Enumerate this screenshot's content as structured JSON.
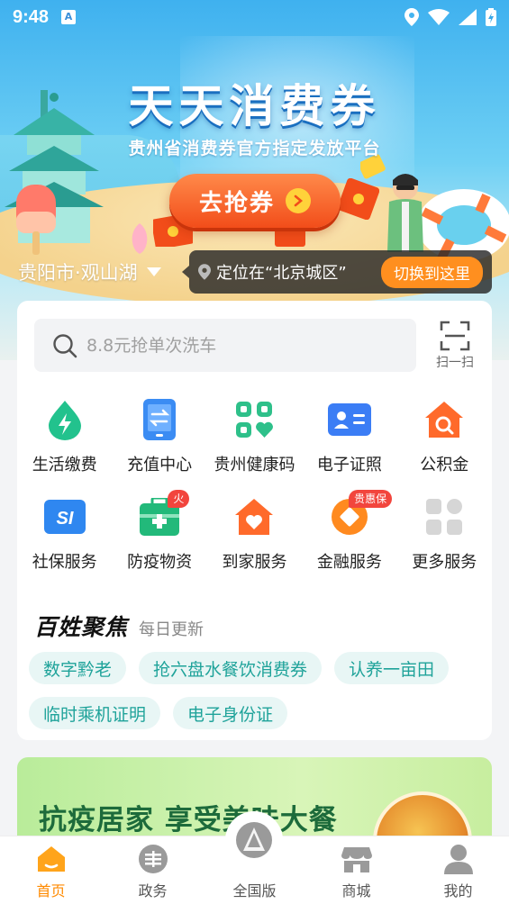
{
  "status_bar": {
    "time": "9:48",
    "notif_glyph": "A"
  },
  "banner": {
    "title": "天天消费券",
    "subtitle": "贵州省消费券官方指定发放平台",
    "cta_label": "去抢券"
  },
  "location": {
    "city": "贵阳市·观山湖",
    "tip_text": "定位在“北京城区”",
    "switch_label": "切换到这里"
  },
  "search": {
    "placeholder": "8.8元抢单次洗车",
    "scan_label": "扫一扫"
  },
  "services": [
    {
      "label": "生活缴费",
      "icon": "bolt-drop-icon",
      "color": "#22c28d"
    },
    {
      "label": "充值中心",
      "icon": "phone-exchange-icon",
      "color": "#3b8cf3"
    },
    {
      "label": "贵州健康码",
      "icon": "health-code-icon",
      "color": "#2ec08a"
    },
    {
      "label": "电子证照",
      "icon": "id-card-icon",
      "color": "#3b7df5"
    },
    {
      "label": "公积金",
      "icon": "house-search-icon",
      "color": "#ff6a2b"
    },
    {
      "label": "社保服务",
      "icon": "si-card-icon",
      "color": "#2f87f0"
    },
    {
      "label": "防疫物资",
      "icon": "medkit-icon",
      "color": "#22b97a",
      "badge": "火"
    },
    {
      "label": "到家服务",
      "icon": "home-heart-icon",
      "color": "#ff6a2b"
    },
    {
      "label": "金融服务",
      "icon": "finance-coin-icon",
      "color": "#ff8a1f",
      "badge": "贵惠保"
    },
    {
      "label": "更多服务",
      "icon": "more-grid-icon",
      "color": "#d6d6d6"
    }
  ],
  "focus": {
    "title": "百姓聚焦",
    "subtitle": "每日更新",
    "tags": [
      "数字黔老",
      "抢六盘水餐饮消费券",
      "认养一亩田",
      "临时乘机证明",
      "电子身份证"
    ]
  },
  "promo": {
    "text": "抗疫居家 享受美味大餐"
  },
  "tabbar": {
    "tabs": [
      {
        "label": "首页",
        "icon": "home-icon",
        "active": true
      },
      {
        "label": "政务",
        "icon": "gov-seal-icon",
        "active": false
      },
      {
        "label": "全国版",
        "icon": "national-mountain-icon",
        "active": false
      },
      {
        "label": "商城",
        "icon": "store-icon",
        "active": false
      },
      {
        "label": "我的",
        "icon": "user-icon",
        "active": false
      }
    ]
  },
  "colors": {
    "accent": "#ff8a00",
    "tag_text": "#1fa39a",
    "tag_bg": "#e8f6f5"
  }
}
